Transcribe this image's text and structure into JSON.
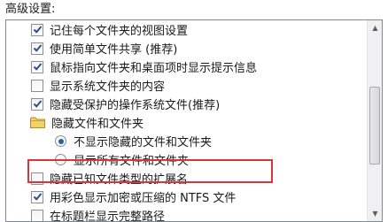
{
  "header": {
    "title": "高级设置:"
  },
  "items": [
    {
      "type": "checkbox",
      "checked": true,
      "label": "记住每个文件夹的视图设置"
    },
    {
      "type": "checkbox",
      "checked": true,
      "label": "使用简单文件共享 (推荐)"
    },
    {
      "type": "checkbox",
      "checked": true,
      "label": "鼠标指向文件夹和桌面项时显示提示信息"
    },
    {
      "type": "checkbox",
      "checked": false,
      "label": "显示系统文件夹的内容"
    },
    {
      "type": "checkbox",
      "checked": true,
      "label": "隐藏受保护的操作系统文件(推荐)"
    },
    {
      "type": "folder",
      "label": "隐藏文件和文件夹"
    },
    {
      "type": "radio",
      "selected": true,
      "label": "不显示隐藏的文件和文件夹"
    },
    {
      "type": "radio",
      "selected": false,
      "label": "显示所有文件和文件夹"
    },
    {
      "type": "checkbox",
      "checked": false,
      "label": "隐藏已知文件类型的扩展名"
    },
    {
      "type": "checkbox",
      "checked": true,
      "label": "用彩色显示加密或压缩的 NTFS 文件"
    },
    {
      "type": "checkbox",
      "checked": false,
      "label": "在标题栏显示完整路径"
    }
  ],
  "colors": {
    "check": "#2a4f8a",
    "highlight_border": "#d9363a",
    "radio_dot": "#2d5fa3"
  }
}
